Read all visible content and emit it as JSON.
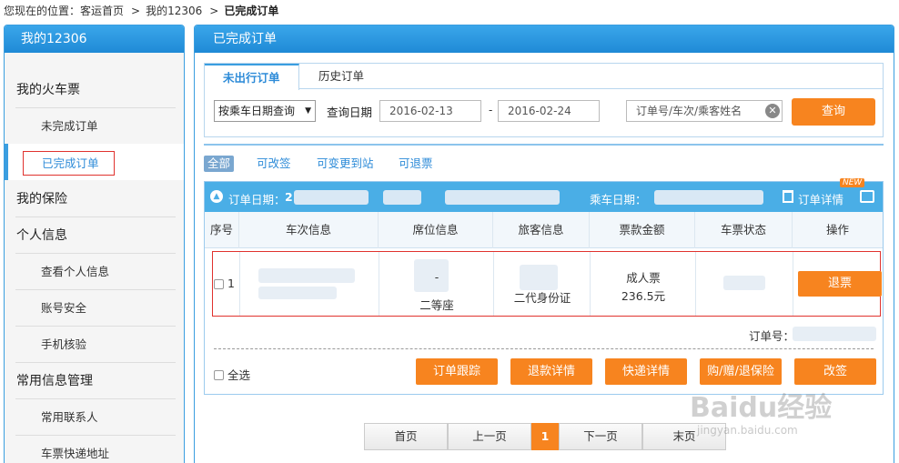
{
  "breadcrumb": {
    "prefix": "您现在的位置：",
    "items": [
      "客运首页",
      "我的12306"
    ],
    "separator": ">",
    "current": "已完成订单"
  },
  "sidebar": {
    "title": "我的12306",
    "groups": [
      {
        "label": "我的火车票",
        "items": [
          "未完成订单",
          "已完成订单"
        ]
      },
      {
        "label": "我的保险",
        "items": []
      },
      {
        "label": "个人信息",
        "items": [
          "查看个人信息",
          "账号安全",
          "手机核验"
        ]
      },
      {
        "label": "常用信息管理",
        "items": [
          "常用联系人",
          "车票快递地址"
        ]
      }
    ],
    "active_item": "已完成订单"
  },
  "main": {
    "title": "已完成订单",
    "tabs": [
      {
        "label": "未出行订单",
        "active": true
      },
      {
        "label": "历史订单",
        "active": false
      }
    ],
    "filter": {
      "query_type": "按乘车日期查询",
      "date_label": "查询日期",
      "date_from": "2016-02-13",
      "date_separator": "-",
      "date_to": "2016-02-24",
      "search_placeholder": "订单号/车次/乘客姓名",
      "query_button": "查询"
    },
    "filter_chips": [
      {
        "label": "全部",
        "active": true
      },
      {
        "label": "可改签",
        "active": false
      },
      {
        "label": "可变更到站",
        "active": false
      },
      {
        "label": "可退票",
        "active": false
      }
    ],
    "order": {
      "order_date_label": "订单日期：",
      "order_date_visible_char": "2",
      "ride_date_label": "乘车日期：",
      "detail_label": "订单详情",
      "new_badge": "NEW",
      "columns": [
        "序号",
        "车次信息",
        "席位信息",
        "旅客信息",
        "票款金额",
        "车票状态",
        "操作"
      ],
      "rows": [
        {
          "index": "1",
          "seat_class": "二等座",
          "seat_symbol": "-",
          "passenger_id_type": "二代身份证",
          "ticket_type": "成人票",
          "amount": "236.5元",
          "action": "退票"
        }
      ],
      "order_no_label": "订单号：",
      "select_all": "全选",
      "actions": [
        "订单跟踪",
        "退款详情",
        "快递详情",
        "购/赠/退保险",
        "改签"
      ]
    },
    "pager": {
      "first": "首页",
      "prev": "上一页",
      "current": "1",
      "next": "下一页",
      "last": "末页"
    }
  },
  "watermark": {
    "logo": "Baidu经验",
    "url": "jingyan.baidu.com"
  },
  "colors": {
    "header_blue": "#1f8ad6",
    "accent_orange": "#f7841f",
    "highlight_red": "#e0322e",
    "link_blue": "#2d8bd8"
  }
}
